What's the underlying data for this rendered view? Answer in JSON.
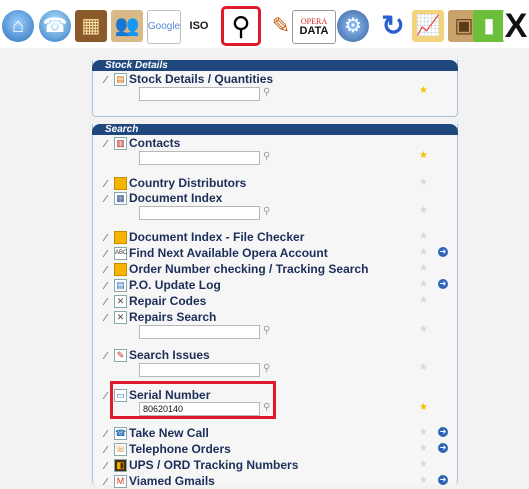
{
  "toolbar": {
    "buttons": [
      {
        "name": "home-button",
        "icon": "home-icon",
        "glyph": "⌂"
      },
      {
        "name": "phone-button",
        "icon": "phone-icon",
        "glyph": "☎"
      },
      {
        "name": "warehouse-button",
        "icon": "warehouse-icon",
        "glyph": "▦"
      },
      {
        "name": "people-button",
        "icon": "people-icon",
        "glyph": "👥"
      },
      {
        "name": "google-button",
        "icon": "google-icon",
        "text": "Google"
      },
      {
        "name": "iso-button",
        "icon": "iso-icon",
        "text": "ISO"
      },
      {
        "name": "search-button",
        "icon": "magnifier-icon",
        "glyph": "⚲",
        "selected": true
      },
      {
        "name": "pencil-button",
        "icon": "pencil-icon",
        "glyph": "✎"
      },
      {
        "name": "opera-data-button",
        "icon": "opera-data-icon",
        "text1": "OPERA",
        "text2": "DATA"
      },
      {
        "name": "settings-button",
        "icon": "gear-icon",
        "glyph": "⚙"
      },
      {
        "name": "refresh-button",
        "icon": "refresh-icon",
        "glyph": "↻"
      },
      {
        "name": "chart-button",
        "icon": "chart-icon",
        "glyph": "📈"
      },
      {
        "name": "box-button",
        "icon": "box-icon",
        "glyph": "▣"
      },
      {
        "name": "book-button",
        "icon": "book-icon",
        "glyph": "▮"
      },
      {
        "name": "close-button",
        "icon": "close-icon",
        "glyph": "X"
      }
    ]
  },
  "stock_panel": {
    "title": "Stock Details",
    "items": [
      {
        "label": "Stock Details / Quantities",
        "star": "★",
        "has_input": true,
        "input_value": ""
      }
    ]
  },
  "search_panel": {
    "title": "Search",
    "items": [
      {
        "label": "Contacts",
        "star": "★"
      },
      {
        "label": "Country Distributors"
      },
      {
        "label": "Document Index"
      },
      {
        "label": "Document Index - File Checker"
      },
      {
        "label": "Find Next Available Opera Account"
      },
      {
        "label": "Order Number checking / Tracking Search"
      },
      {
        "label": "P.O. Update Log"
      },
      {
        "label": "Repair Codes"
      },
      {
        "label": "Repairs Search"
      },
      {
        "label": "Search Issues"
      },
      {
        "label": "Serial Number",
        "input_value": "80620140",
        "star": "★"
      },
      {
        "label": "Take New Call"
      },
      {
        "label": "Telephone Orders"
      },
      {
        "label": "UPS / ORD Tracking Numbers"
      },
      {
        "label": "Viamed Gmails"
      }
    ]
  },
  "colors": {
    "panel_header": "#21477f",
    "label_text": "#1c2f59",
    "highlight_box": "#e0192b",
    "star_active": "#f2c200"
  }
}
